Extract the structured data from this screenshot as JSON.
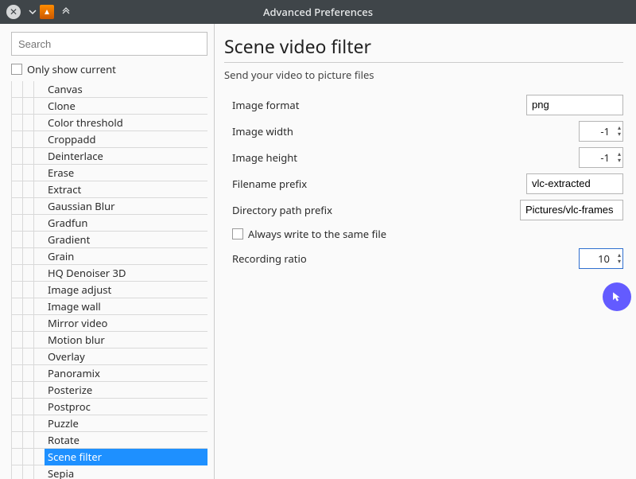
{
  "window": {
    "title": "Advanced Preferences"
  },
  "sidebar": {
    "search_placeholder": "Search",
    "only_show_label": "Only show current",
    "items": [
      "Canvas",
      "Clone",
      "Color threshold",
      "Croppadd",
      "Deinterlace",
      "Erase",
      "Extract",
      "Gaussian Blur",
      "Gradfun",
      "Gradient",
      "Grain",
      "HQ Denoiser 3D",
      "Image adjust",
      "Image wall",
      "Mirror video",
      "Motion blur",
      "Overlay",
      "Panoramix",
      "Posterize",
      "Postproc",
      "Puzzle",
      "Rotate",
      "Scene filter",
      "Sepia"
    ],
    "selected_index": 22
  },
  "panel": {
    "title": "Scene video filter",
    "subtitle": "Send your video to picture files",
    "fields": {
      "image_format": {
        "label": "Image format",
        "value": "png"
      },
      "image_width": {
        "label": "Image width",
        "value": "-1"
      },
      "image_height": {
        "label": "Image height",
        "value": "-1"
      },
      "filename_prefix": {
        "label": "Filename prefix",
        "value": "vlc-extracted"
      },
      "directory_prefix": {
        "label": "Directory path prefix",
        "value": "Pictures/vlc-frames"
      },
      "always_write": {
        "label": "Always write to the same file",
        "checked": false
      },
      "recording_ratio": {
        "label": "Recording ratio",
        "value": "10"
      }
    }
  }
}
